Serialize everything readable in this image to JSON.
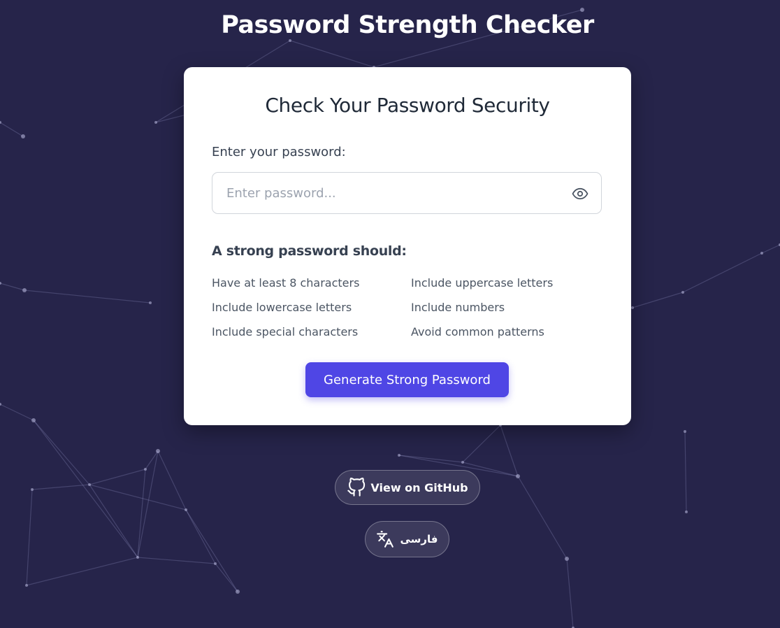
{
  "header": {
    "title": "Password Strength Checker"
  },
  "card": {
    "title": "Check Your Password Security",
    "field_label": "Enter your password:",
    "password_value": "",
    "password_placeholder": "Enter password...",
    "toggle_icon": "eye-icon",
    "requirements_heading": "A strong password should:",
    "requirements": [
      "Have at least 8 characters",
      "Include uppercase letters",
      "Include lowercase letters",
      "Include numbers",
      "Include special characters",
      "Avoid common patterns"
    ],
    "generate_label": "Generate Strong Password"
  },
  "footer": {
    "github_label": "View on GitHub",
    "github_icon": "github-icon",
    "language_label": "فارسی",
    "language_icon": "translate-icon"
  },
  "colors": {
    "background": "#26244a",
    "accent": "#4f46e5",
    "card": "#ffffff"
  }
}
